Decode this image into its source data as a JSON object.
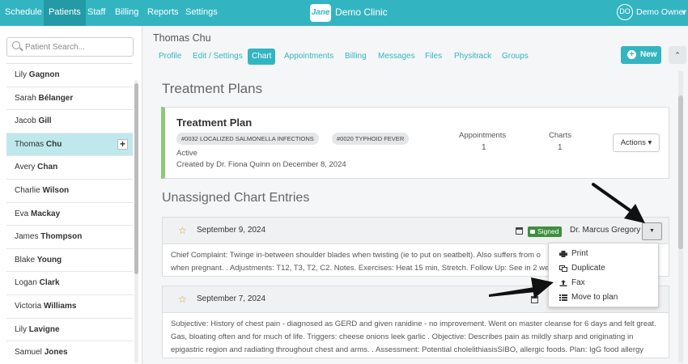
{
  "nav": {
    "items": [
      "Schedule",
      "Patients",
      "Staff",
      "Billing",
      "Reports",
      "Settings"
    ],
    "active": "Patients",
    "logo": "Jane",
    "clinic_name": "Demo Clinic",
    "user_initials": "DO",
    "user_name": "Demo Owner"
  },
  "sidebar": {
    "search_placeholder": "Patient Search...",
    "patients": [
      {
        "first": "Lily",
        "last": "Gagnon"
      },
      {
        "first": "Sarah",
        "last": "Bélanger"
      },
      {
        "first": "Jacob",
        "last": "Gill"
      },
      {
        "first": "Thomas",
        "last": "Chu",
        "selected": true
      },
      {
        "first": "Avery",
        "last": "Chan"
      },
      {
        "first": "Charlie",
        "last": "Wilson"
      },
      {
        "first": "Eva",
        "last": "Mackay"
      },
      {
        "first": "James",
        "last": "Thompson"
      },
      {
        "first": "Blake",
        "last": "Young"
      },
      {
        "first": "Logan",
        "last": "Clark"
      },
      {
        "first": "Victoria",
        "last": "Williams"
      },
      {
        "first": "Lily",
        "last": "Lavigne"
      },
      {
        "first": "Samuel",
        "last": "Jones"
      }
    ],
    "add_label": "+"
  },
  "patient": {
    "name": "Thomas Chu",
    "tabs": [
      "Profile",
      "Edit / Settings",
      "Chart",
      "Appointments",
      "Billing",
      "Messages",
      "Files",
      "Physitrack",
      "Groups"
    ],
    "active_tab": "Chart",
    "new_label": "New",
    "new_plus": "+",
    "collapse_label": "⌃"
  },
  "treatment_plans": {
    "heading": "Treatment Plans",
    "title": "Treatment Plan",
    "tags": [
      "#0032 LOCALIZED SALMONELLA INFECTIONS",
      "#0020 TYPHOID FEVER"
    ],
    "status": "Active",
    "created": "Created by Dr. Fiona Quinn on December 8, 2024",
    "appointments_label": "Appointments",
    "appointments_value": "1",
    "charts_label": "Charts",
    "charts_value": "1",
    "actions_label": "Actions ▾"
  },
  "chart_entries": {
    "heading": "Unassigned Chart Entries",
    "entries": [
      {
        "date": "September 9, 2024",
        "signed": "Signed",
        "doctor": "Dr. Marcus Gregory",
        "caret": "▼",
        "line1": "Chief Complaint: Twinge in-between shoulder blades when twisting (ie to put on seatbelt). Also suffers from o",
        "line2": "when pregnant. . Adjustments: T12, T3, T2, C2. Notes. Exercises: Heat 15 min, Stretch. Follow Up: See in 2 wee"
      },
      {
        "date": "September 7, 2024",
        "line1": "Subjective: History of chest pain - diagnosed as GERD and given ranidine - no improvement. Went on master cleanse for 6 days and felt great.",
        "line2": "Gas, bloating often and for much of life. Triggers: cheese onions leek garlic . Objective: Describes pain as mildly sharp and originating in",
        "line3": "epigastric region and radiating throughout chest and arms. . Assessment: Potential cholelithiasisSIBO, allergic foods. Plan: IgG food allergy"
      }
    ],
    "star": "☆"
  },
  "menu": {
    "items": [
      "Print",
      "Duplicate",
      "Fax",
      "Move to plan"
    ]
  },
  "colors": {
    "brand": "#33b5c1",
    "active_nav": "#239aa5",
    "signed": "#3e8f3e",
    "plan_accent": "#8cc97a"
  }
}
